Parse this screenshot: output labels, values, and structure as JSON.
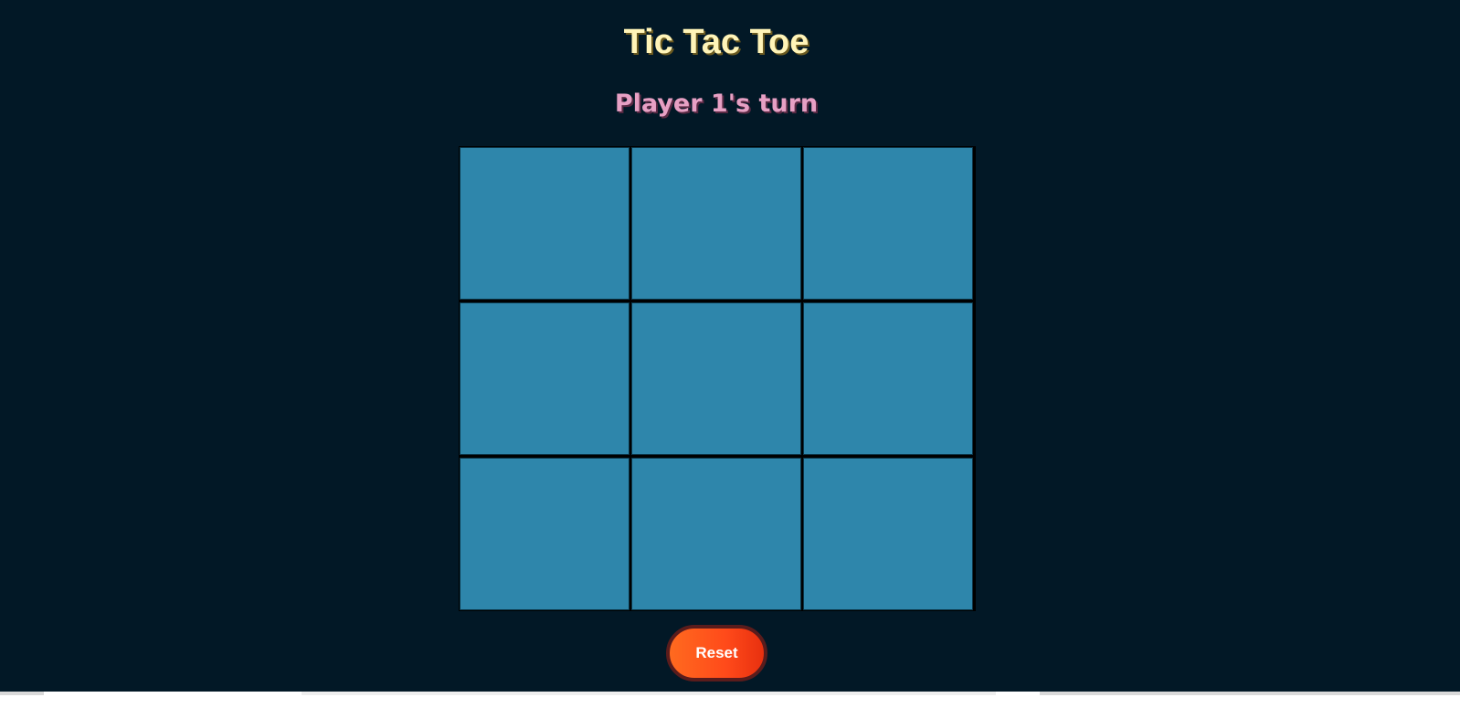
{
  "header": {
    "title": "Tic Tac Toe",
    "status": "Player 1's turn"
  },
  "board": {
    "cells": [
      "",
      "",
      "",
      "",
      "",
      "",
      "",
      "",
      ""
    ]
  },
  "controls": {
    "reset_label": "Reset"
  },
  "colors": {
    "background": "#021826",
    "cell": "#2e86ab",
    "title": "#fff4b8",
    "status": "#e7a0c4",
    "reset_start": "#ff6a1f",
    "reset_end": "#e8300f"
  }
}
